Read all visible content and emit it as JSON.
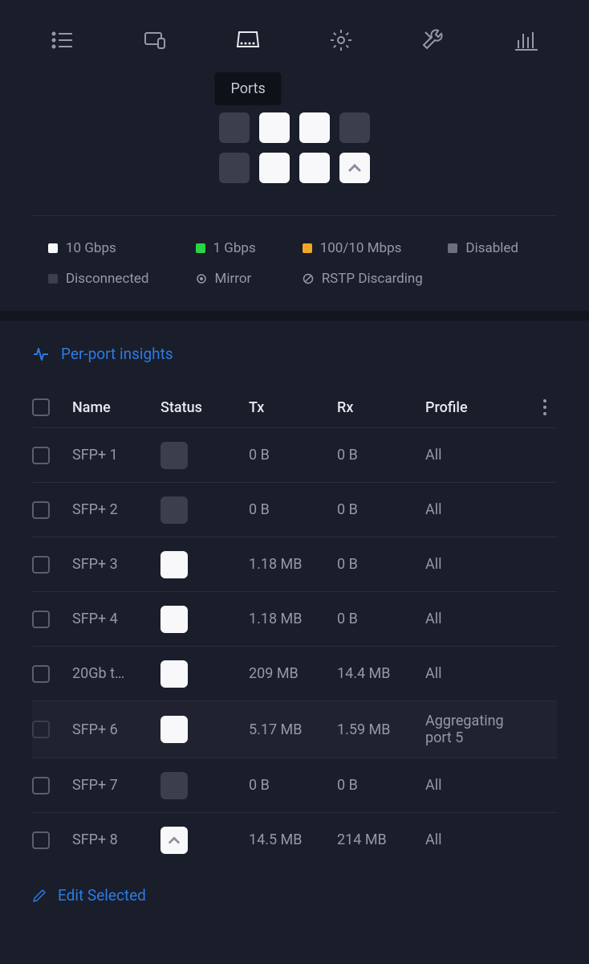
{
  "tooltip": "Ports",
  "legend": {
    "speed10g": "10 Gbps",
    "speed1g": "1 Gbps",
    "speed100": "100/10 Mbps",
    "disabled": "Disabled",
    "disconnected": "Disconnected",
    "mirror": "Mirror",
    "rstp": "RSTP Discarding"
  },
  "insights_label": "Per-port insights",
  "columns": {
    "name": "Name",
    "status": "Status",
    "tx": "Tx",
    "rx": "Rx",
    "profile": "Profile"
  },
  "rows": [
    {
      "name": "SFP+ 1",
      "status": "disconnected",
      "tx": "0 B",
      "rx": "0 B",
      "profile": "All"
    },
    {
      "name": "SFP+ 2",
      "status": "disconnected",
      "tx": "0 B",
      "rx": "0 B",
      "profile": "All"
    },
    {
      "name": "SFP+ 3",
      "status": "10g",
      "tx": "1.18 MB",
      "rx": "0 B",
      "profile": "All"
    },
    {
      "name": "SFP+ 4",
      "status": "10g",
      "tx": "1.18 MB",
      "rx": "0 B",
      "profile": "All"
    },
    {
      "name": "20Gb t…",
      "status": "10g",
      "tx": "209 MB",
      "rx": "14.4 MB",
      "profile": "All"
    },
    {
      "name": "SFP+ 6",
      "status": "10g",
      "tx": "5.17 MB",
      "rx": "1.59 MB",
      "profile": "Aggregating port 5"
    },
    {
      "name": "SFP+ 7",
      "status": "disconnected",
      "tx": "0 B",
      "rx": "0 B",
      "profile": "All"
    },
    {
      "name": "SFP+ 8",
      "status": "uplink",
      "tx": "14.5 MB",
      "rx": "214 MB",
      "profile": "All"
    }
  ],
  "edit_label": "Edit Selected"
}
